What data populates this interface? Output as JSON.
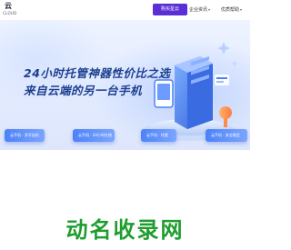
{
  "header": {
    "logo": {
      "text": "云",
      "subtext": "CLOUD"
    },
    "buy_button": "购买星云",
    "nav": [
      {
        "label": "企业资讯",
        "icon": "chevron-down-icon"
      },
      {
        "label": "优质帮助",
        "icon": "chevron-down-icon"
      }
    ]
  },
  "hero": {
    "headline_line1": "24小时托管神器性价比之选",
    "headline_line2": "来自云端的另一台手机",
    "feature_pills": [
      {
        "label": "云手机 · 多开挂机"
      },
      {
        "label": "云手机 · 24小时在线"
      },
      {
        "label": "云手机 · 托管"
      },
      {
        "label": "云手机 · 安全稳定"
      }
    ],
    "illustration": "cloud-phone-server-illustration"
  },
  "watermark": {
    "text": "动名收录网"
  },
  "colors": {
    "brand_purple": "#5b2fd6",
    "headline_blue": "#1d3f8f",
    "pill_blue": "#4d82f7",
    "watermark_green": "#1f9d2e"
  }
}
